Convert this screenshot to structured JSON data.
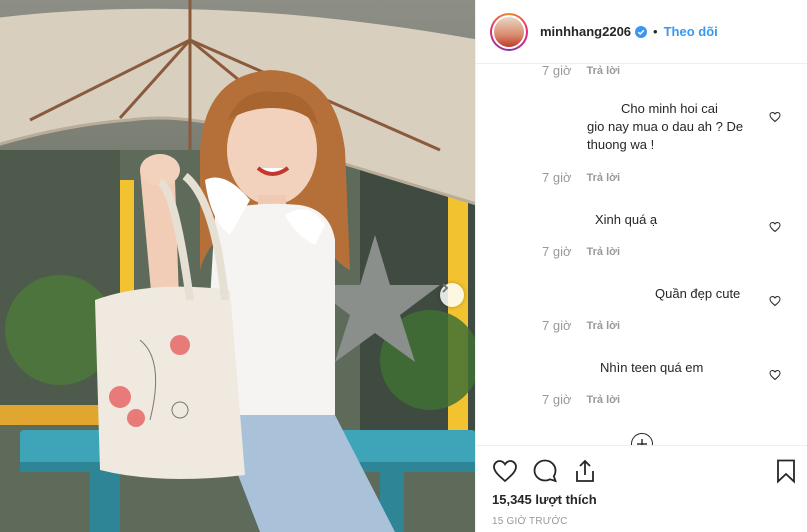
{
  "post": {
    "username": "minhhang2206",
    "verified_icon": "verified-badge-icon",
    "separator": "•",
    "follow_label": "Theo dõi",
    "accent_color": "#3897f0",
    "photo_icon_next": "chevron-right-icon"
  },
  "comments": {
    "partial": {
      "time": "7 giờ",
      "reply": "Trả lời"
    },
    "items": [
      {
        "text_lines": [
          "Cho minh hoi cai",
          "gio nay mua o dau ah ? De",
          "thuong wa !"
        ],
        "time": "7 giờ",
        "reply": "Trả lời"
      },
      {
        "text_lines": [
          "Xinh quá ạ"
        ],
        "time": "7 giờ",
        "reply": "Trả lời"
      },
      {
        "text_lines": [
          "Quần đẹp cute"
        ],
        "time": "7 giờ",
        "reply": "Trả lời"
      },
      {
        "text_lines": [
          "Nhìn teen quá em"
        ],
        "time": "7 giờ",
        "reply": "Trả lời"
      }
    ],
    "load_more_icon": "plus-circle-icon"
  },
  "actions": {
    "like_icon": "heart-icon",
    "comment_icon": "comment-bubble-icon",
    "share_icon": "share-icon",
    "save_icon": "bookmark-icon",
    "likes_text": "15,345 lượt thích",
    "time_ago": "15 GIỜ TRƯỚC"
  }
}
